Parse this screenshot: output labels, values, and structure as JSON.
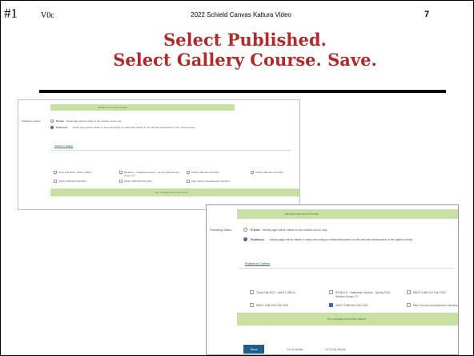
{
  "header": {
    "slide_number": "#1",
    "version": "V0c",
    "source": "2022 Schield Canvas Kaltura Video",
    "page": "7"
  },
  "title": {
    "line1": "Select Published.",
    "line2": "Select Gallery Course. Save."
  },
  "colors": {
    "title": "#b02a2a",
    "green_bar": "#c8e0a4",
    "save_button": "#1f5f8b",
    "checked": "#3a6bb0"
  },
  "screenshot_small": {
    "top_banner": "Media is now set to Private",
    "publishing_status_label": "Publishing Status:",
    "private_label": "Private",
    "private_desc": "- Media page will be visible to the media's owner only.",
    "published_label": "Published",
    "published_desc": "- Media page will be visible to users according to entitlement based on the selected destinations in the options below.",
    "tab": "Publish in Gallery",
    "courses": [
      {
        "label": "Temp Fall 2022 - MATH 1380 A",
        "checked": false
      },
      {
        "label": "RR BULK - Statistical Literacy - Spring 2022 Section Group: FY",
        "checked": false
      },
      {
        "label": "MATH 1380 001 Fall 2022",
        "checked": false
      },
      {
        "label": "MATH 1380 001 Fall 2022",
        "checked": false
      },
      {
        "label": "MATH 1380 002 Fall 2021",
        "checked": false
      },
      {
        "label": "MATH 1380 002 Fall 2021",
        "checked": false
      },
      {
        "label": "Nike School cochairperson Sandbox",
        "checked": false
      }
    ],
    "saved_banner": "Your changes have been saved"
  },
  "screenshot_large": {
    "top_banner": "Media is now set to Private",
    "publishing_status_label": "Publishing Status:",
    "private_label": "Private",
    "private_desc": "- Media page will be visible to the media's owner only.",
    "published_label": "Published",
    "published_desc": "- Media page will be visible to users according to entitlement based on the selected destinations in the options below.",
    "tab": "Publish in Gallery",
    "courses": [
      {
        "label": "Temp Fall 2022 - MATH 1380 A",
        "checked": false
      },
      {
        "label": "RR BULK - Statistical Literacy - Spring 2022 Section Group: FY",
        "checked": false
      },
      {
        "label": "MATH 1380 001 Fall 2022",
        "checked": false
      },
      {
        "label": "MATH 1380 002 Fall 2021",
        "checked": false
      },
      {
        "label": "MATH 1380 001 Fall 2022",
        "checked": true
      },
      {
        "label": "Nike School cochairperson Sandbox",
        "checked": false
      }
    ],
    "saved_banner": "Your changes have been saved",
    "save_button": "Save",
    "go_to_media": "Go To Media",
    "go_to_my_media": "Go To My Media"
  }
}
